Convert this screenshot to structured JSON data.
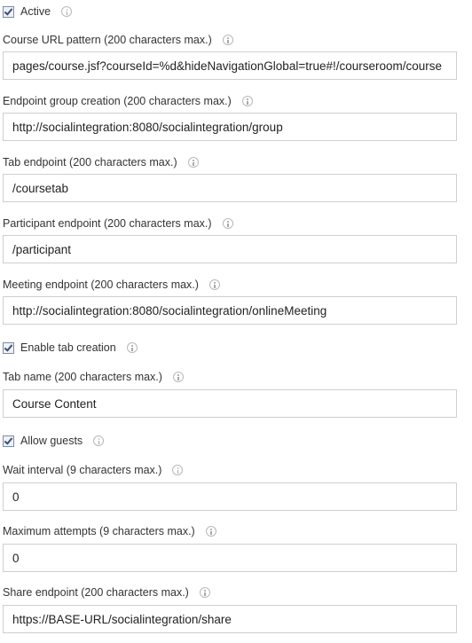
{
  "active": {
    "label": "Active",
    "checked": true
  },
  "course_url_pattern": {
    "label": "Course URL pattern (200 characters max.)",
    "value": "pages/course.jsf?courseId=%d&hideNavigationGlobal=true#!/courseroom/course"
  },
  "endpoint_group_creation": {
    "label": "Endpoint group creation (200 characters max.)",
    "value": "http://socialintegration:8080/socialintegration/group"
  },
  "tab_endpoint": {
    "label": "Tab endpoint (200 characters max.)",
    "value": "/coursetab"
  },
  "participant_endpoint": {
    "label": "Participant endpoint (200 characters max.)",
    "value": "/participant"
  },
  "meeting_endpoint": {
    "label": "Meeting endpoint (200 characters max.)",
    "value": "http://socialintegration:8080/socialintegration/onlineMeeting"
  },
  "enable_tab_creation": {
    "label": "Enable tab creation",
    "checked": true
  },
  "tab_name": {
    "label": "Tab name (200 characters max.)",
    "value": "Course Content"
  },
  "allow_guests": {
    "label": "Allow guests",
    "checked": true
  },
  "wait_interval": {
    "label": "Wait interval (9 characters max.)",
    "value": "0"
  },
  "maximum_attempts": {
    "label": "Maximum attempts (9 characters max.)",
    "value": "0"
  },
  "share_endpoint": {
    "label": "Share endpoint (200 characters max.)",
    "value": "https://BASE-URL/socialintegration/share"
  },
  "icons": {
    "info": "info-icon",
    "check": "checkmark-icon"
  }
}
